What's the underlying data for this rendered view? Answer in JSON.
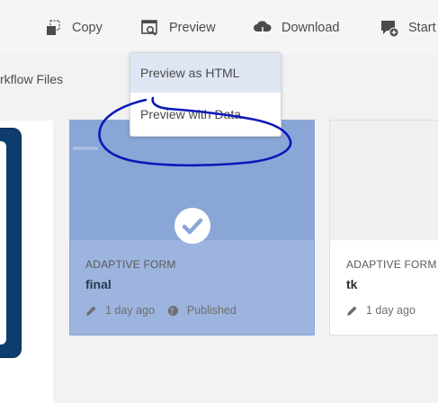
{
  "toolbar": {
    "copy_label": "Copy",
    "preview_label": "Preview",
    "download_label": "Download",
    "start_label": "Start I"
  },
  "breadcrumb": {
    "label": "rkflow Files"
  },
  "preview_menu": {
    "items": [
      "Preview as HTML",
      "Preview with Data"
    ],
    "selected_index": 0
  },
  "cards": [
    {
      "type": "ADAPTIVE FORM",
      "name": "final",
      "modified": "1 day ago",
      "status": "Published",
      "selected": true
    },
    {
      "type": "ADAPTIVE FORM",
      "name": "tk",
      "modified": "1 day ago",
      "selected": false
    }
  ],
  "colors": {
    "selection": "#8aa6d6",
    "annotation": "#0a18b8"
  }
}
